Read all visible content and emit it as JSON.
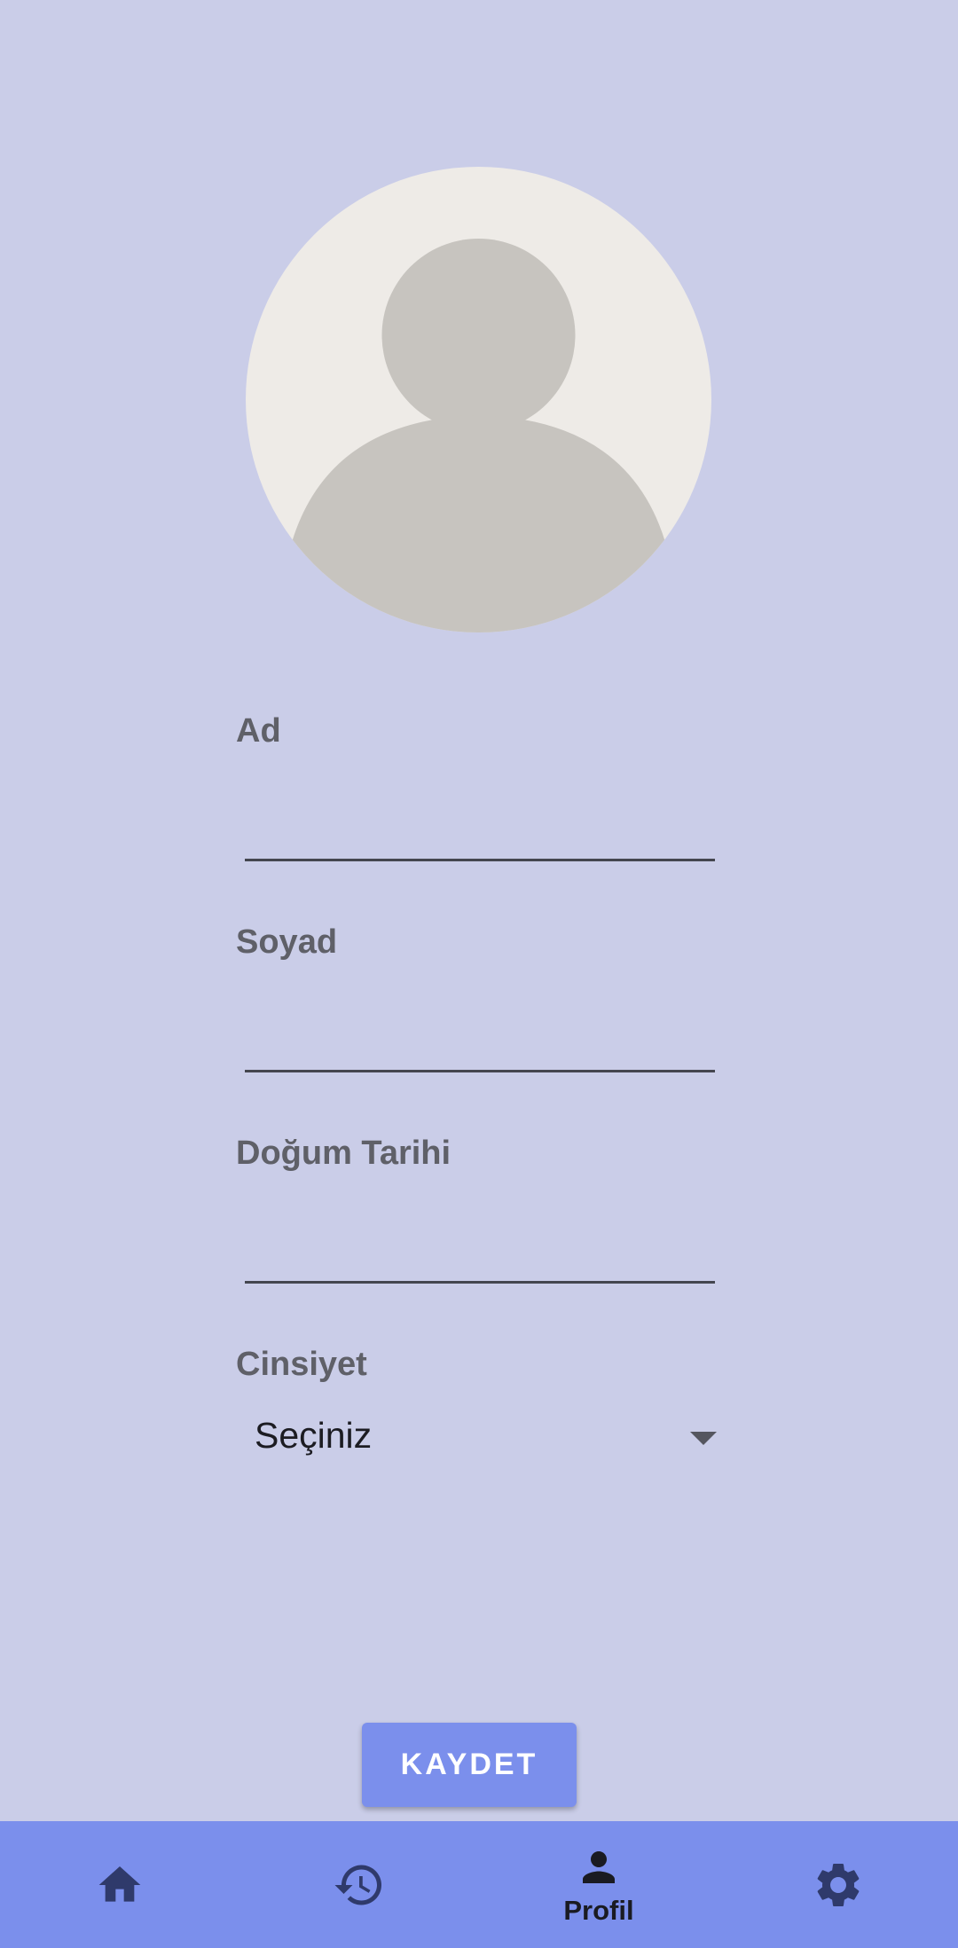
{
  "profile": {
    "avatar_icon": "default-person-avatar"
  },
  "form": {
    "first_name": {
      "label": "Ad",
      "value": ""
    },
    "last_name": {
      "label": "Soyad",
      "value": ""
    },
    "birth_date": {
      "label": "Doğum Tarihi",
      "value": ""
    },
    "gender": {
      "label": "Cinsiyet",
      "selected": "Seçiniz"
    }
  },
  "actions": {
    "save_label": "KAYDET"
  },
  "bottom_nav": {
    "items": [
      {
        "icon": "home-icon",
        "label": "",
        "active": false
      },
      {
        "icon": "history-icon",
        "label": "",
        "active": false
      },
      {
        "icon": "person-icon",
        "label": "Profil",
        "active": true
      },
      {
        "icon": "gear-icon",
        "label": "",
        "active": false
      }
    ]
  },
  "colors": {
    "background": "#cacde8",
    "accent": "#7b8fec",
    "nav_icon": "#2f3a6b",
    "active_icon": "#1a1b22"
  }
}
